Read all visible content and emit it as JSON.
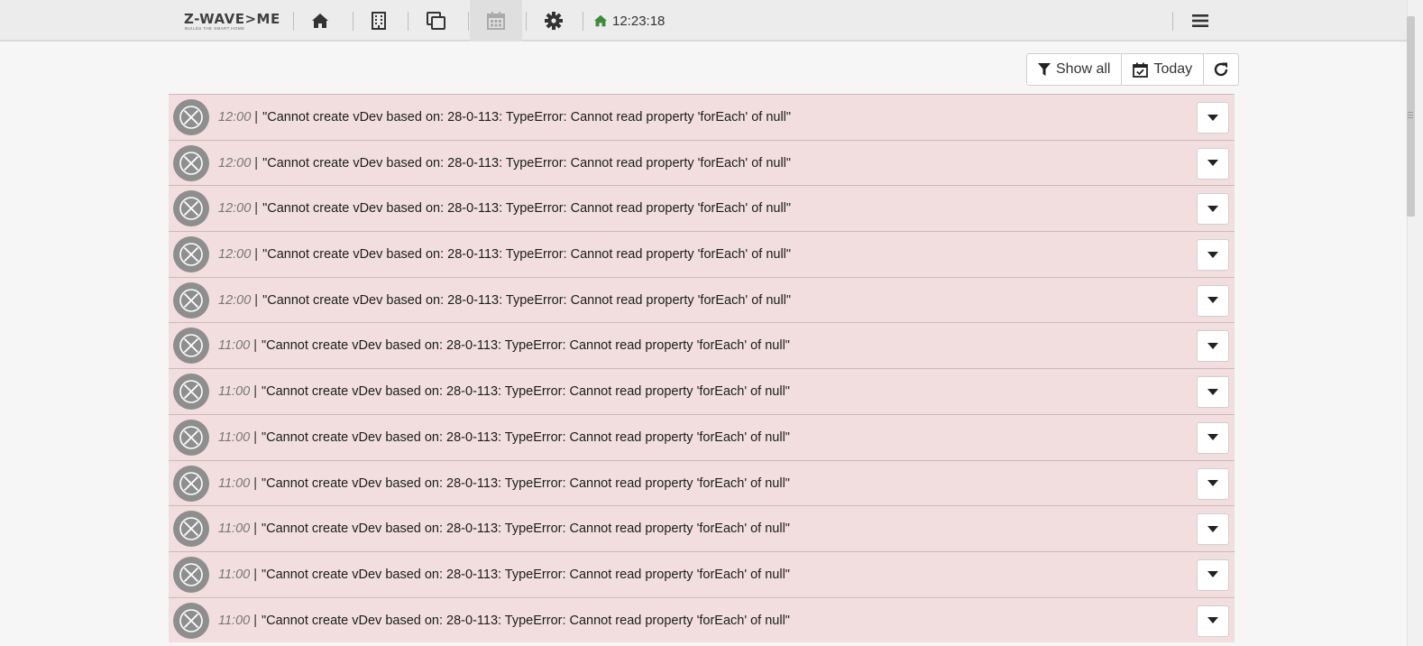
{
  "brand": {
    "name": "Z-WAVE>ME",
    "tagline": "BUILDS THE SMART HOME"
  },
  "nav": {
    "items": [
      {
        "name": "home",
        "icon": "home-icon"
      },
      {
        "name": "rooms",
        "icon": "building-icon"
      },
      {
        "name": "elements",
        "icon": "clone-icon"
      },
      {
        "name": "events",
        "icon": "calendar-icon",
        "active": true
      },
      {
        "name": "settings",
        "icon": "gear-icon"
      }
    ],
    "clock": "12:23:18",
    "menu_icon": "bars-icon"
  },
  "toolbar": {
    "show_all_label": "Show all",
    "today_label": "Today",
    "refresh_icon": "refresh-icon"
  },
  "events": [
    {
      "time": "12:00",
      "message": "\"Cannot create vDev based on: 28-0-113: TypeError: Cannot read property 'forEach' of null\""
    },
    {
      "time": "12:00",
      "message": "\"Cannot create vDev based on: 28-0-113: TypeError: Cannot read property 'forEach' of null\""
    },
    {
      "time": "12:00",
      "message": "\"Cannot create vDev based on: 28-0-113: TypeError: Cannot read property 'forEach' of null\""
    },
    {
      "time": "12:00",
      "message": "\"Cannot create vDev based on: 28-0-113: TypeError: Cannot read property 'forEach' of null\""
    },
    {
      "time": "12:00",
      "message": "\"Cannot create vDev based on: 28-0-113: TypeError: Cannot read property 'forEach' of null\""
    },
    {
      "time": "11:00",
      "message": "\"Cannot create vDev based on: 28-0-113: TypeError: Cannot read property 'forEach' of null\""
    },
    {
      "time": "11:00",
      "message": "\"Cannot create vDev based on: 28-0-113: TypeError: Cannot read property 'forEach' of null\""
    },
    {
      "time": "11:00",
      "message": "\"Cannot create vDev based on: 28-0-113: TypeError: Cannot read property 'forEach' of null\""
    },
    {
      "time": "11:00",
      "message": "\"Cannot create vDev based on: 28-0-113: TypeError: Cannot read property 'forEach' of null\""
    },
    {
      "time": "11:00",
      "message": "\"Cannot create vDev based on: 28-0-113: TypeError: Cannot read property 'forEach' of null\""
    },
    {
      "time": "11:00",
      "message": "\"Cannot create vDev based on: 28-0-113: TypeError: Cannot read property 'forEach' of null\""
    },
    {
      "time": "11:00",
      "message": "\"Cannot create vDev based on: 28-0-113: TypeError: Cannot read property 'forEach' of null\""
    }
  ],
  "colors": {
    "error_row": "#f2dede",
    "clock_icon": "#3c8c3c"
  }
}
